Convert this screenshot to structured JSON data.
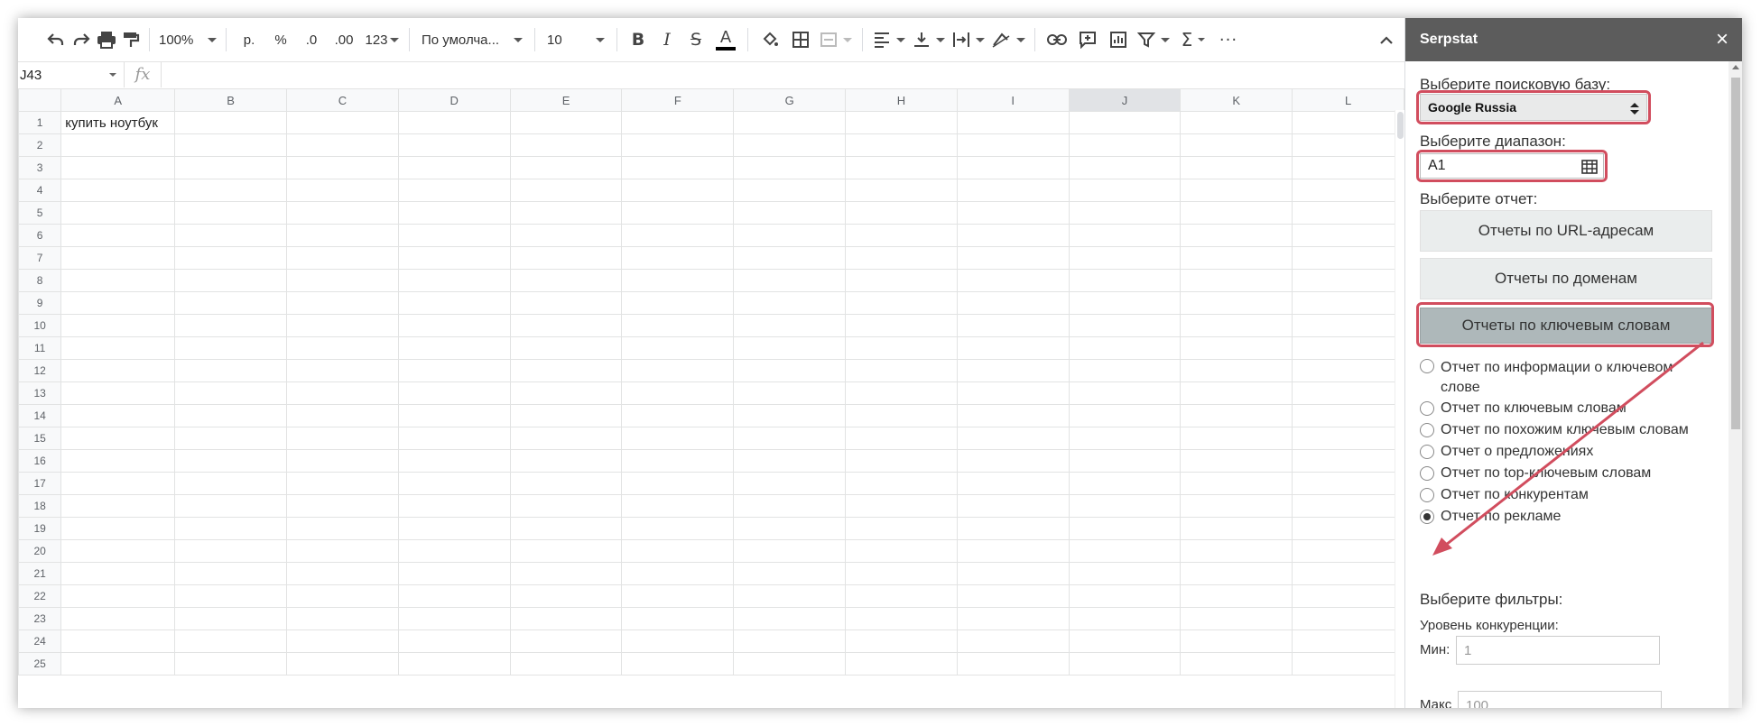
{
  "toolbar": {
    "zoom": "100%",
    "currency": "р.",
    "percent": "%",
    "dec_less": ".0",
    "dec_more": ".00",
    "number_format": "123",
    "font": "По умолча...",
    "font_size": "10"
  },
  "formula_bar": {
    "name_box": "J43",
    "fx": "fx"
  },
  "grid": {
    "columns": [
      "A",
      "B",
      "C",
      "D",
      "E",
      "F",
      "G",
      "H",
      "I",
      "J",
      "K",
      "L"
    ],
    "rows": [
      "1",
      "2",
      "3",
      "4",
      "5",
      "6",
      "7",
      "8",
      "9",
      "10",
      "11",
      "12",
      "13",
      "14",
      "15",
      "16",
      "17",
      "18",
      "19",
      "20",
      "21",
      "22",
      "23",
      "24",
      "25"
    ],
    "cell_a1": "купить ноутбук"
  },
  "sidebar": {
    "title": "Serpstat",
    "close": "×",
    "db_label": "Выберите поисковую базу:",
    "db_value": "Google Russia",
    "range_label": "Выберите диапазон:",
    "range_value": "A1",
    "report_label": "Выберите отчет:",
    "btn_url": "Отчеты по URL-адресам",
    "btn_domain": "Отчеты по доменам",
    "btn_keywords": "Отчеты по ключевым словам",
    "radios": [
      "Отчет по информации о ключевом слове",
      "Отчет по ключевым словам",
      "Отчет по похожим ключевым словам",
      "Отчет о предложениях",
      "Отчет по top-ключевым словам",
      "Отчет по конкурентам",
      "Отчет по рекламе"
    ],
    "filters_label": "Выберите фильтры:",
    "competition_label": "Уровень конкуренции:",
    "min_label": "Мин:",
    "min_placeholder": "1",
    "max_label": "Макс",
    "max_placeholder": "100"
  },
  "colors": {
    "highlight": "#d14d5e",
    "header": "#5c5c5c",
    "active_button": "#aeb8ba"
  }
}
